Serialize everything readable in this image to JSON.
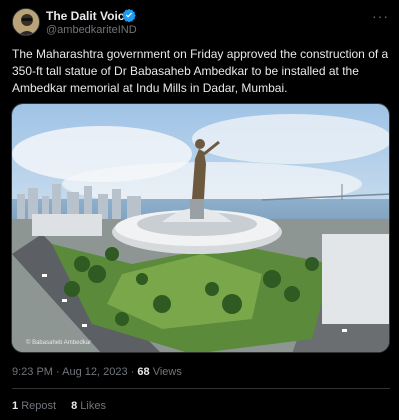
{
  "author": {
    "name": "The Dalit Voice",
    "handle": "@ambedkariteIND",
    "verified_color": "#1d9bf0"
  },
  "tweet": {
    "text": "The Maharashtra government on Friday approved the construction of a 350-ft tall statue of Dr Babasaheb Ambedkar to be installed at the Ambedkar memorial at Indu Mills in Dadar, Mumbai.",
    "media_caption": "© Babasaheb Ambedkar"
  },
  "meta": {
    "time": "9:23 PM",
    "date": "Aug 12, 2023",
    "views_count": "68",
    "views_label": "Views"
  },
  "stats": {
    "reposts_count": "1",
    "reposts_label": "Repost",
    "likes_count": "8",
    "likes_label": "Likes"
  },
  "icons": {
    "more": "more-options-icon",
    "verified": "verified-badge-icon"
  }
}
